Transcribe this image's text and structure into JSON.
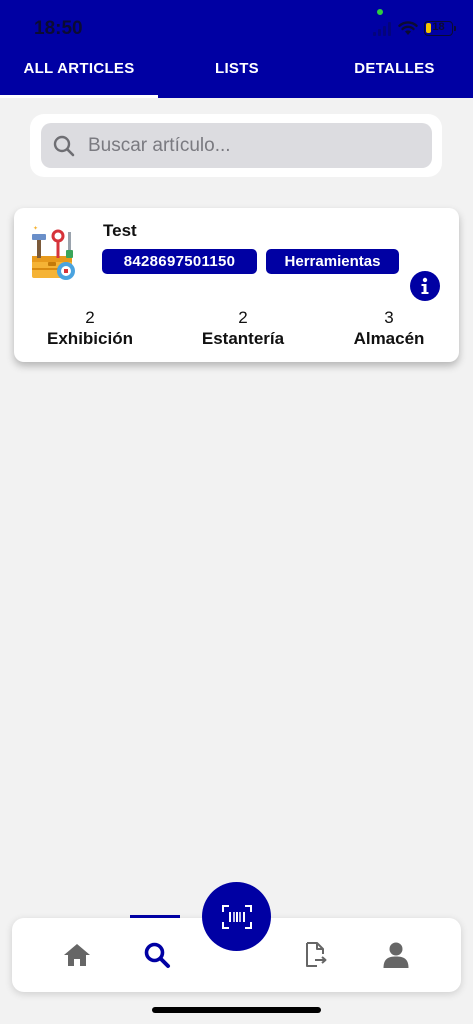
{
  "status_bar": {
    "time": "18:50",
    "battery": "18"
  },
  "tabs": [
    {
      "label": "ALL ARTICLES",
      "active": true
    },
    {
      "label": "LISTS",
      "active": false
    },
    {
      "label": "DETALLES",
      "active": false
    }
  ],
  "search": {
    "placeholder": "Buscar artículo...",
    "value": ""
  },
  "article": {
    "name": "Test",
    "code": "8428697501150",
    "category": "Herramientas",
    "image_icon": "toolbox-icon",
    "stock": [
      {
        "value": "2",
        "label": "Exhibición"
      },
      {
        "value": "2",
        "label": "Estantería"
      },
      {
        "value": "3",
        "label": "Almacén"
      }
    ]
  },
  "bottom_nav": {
    "items": [
      {
        "icon": "home-icon",
        "active": false
      },
      {
        "icon": "search-icon",
        "active": true
      },
      {
        "icon": "barcode-scan-icon",
        "active": false
      },
      {
        "icon": "file-export-icon",
        "active": false
      },
      {
        "icon": "user-icon",
        "active": false
      }
    ]
  },
  "colors": {
    "primary": "#0000a3",
    "background": "#f2f2f2",
    "nav_inactive": "#666666"
  }
}
